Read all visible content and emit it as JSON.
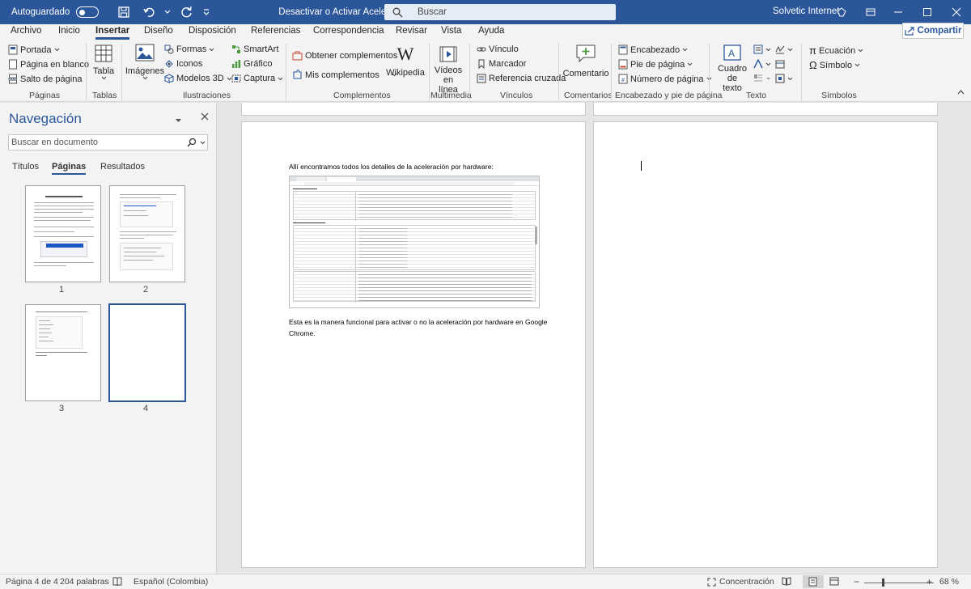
{
  "titlebar": {
    "autosave_label": "Autoguardado",
    "doc_title": "Desactivar o Activar Aceler...",
    "search_placeholder": "Buscar",
    "user_name": "Solvetic Internet"
  },
  "tabs": [
    "Archivo",
    "Inicio",
    "Insertar",
    "Diseño",
    "Disposición",
    "Referencias",
    "Correspondencia",
    "Revisar",
    "Vista",
    "Ayuda"
  ],
  "active_tab": "Insertar",
  "share_label": "Compartir",
  "ribbon": {
    "paginas": {
      "portada": "Portada",
      "pagina_blanco": "Página en blanco",
      "salto": "Salto de página",
      "label": "Páginas"
    },
    "tablas": {
      "tabla": "Tabla",
      "label": "Tablas"
    },
    "ilustraciones": {
      "imagenes": "Imágenes",
      "formas": "Formas",
      "iconos": "Iconos",
      "modelos": "Modelos 3D",
      "smartart": "SmartArt",
      "grafico": "Gráfico",
      "captura": "Captura",
      "label": "Ilustraciones"
    },
    "complementos": {
      "obtener": "Obtener complementos",
      "mis": "Mis complementos",
      "wikipedia": "Wikipedia",
      "label": "Complementos"
    },
    "multimedia": {
      "videos_1": "Vídeos",
      "videos_2": "en línea",
      "label": "Multimedia"
    },
    "vinculos": {
      "vinculo": "Vínculo",
      "marcador": "Marcador",
      "referencia": "Referencia cruzada",
      "label": "Vínculos"
    },
    "comentarios": {
      "comentario": "Comentario",
      "label": "Comentarios"
    },
    "encabezado": {
      "encabezado": "Encabezado",
      "pie": "Pie de página",
      "numero": "Número de página",
      "label": "Encabezado y pie de página"
    },
    "texto": {
      "cuadro_1": "Cuadro de",
      "cuadro_2": "texto",
      "label": "Texto"
    },
    "simbolos": {
      "ecuacion": "Ecuación",
      "simbolo": "Símbolo",
      "label": "Símbolos"
    }
  },
  "nav": {
    "title": "Navegación",
    "search_placeholder": "Buscar en documento",
    "tabs": [
      "Títulos",
      "Páginas",
      "Resultados"
    ],
    "active_tab": "Páginas",
    "pages": [
      "1",
      "2",
      "3",
      "4"
    ],
    "selected_page": "4"
  },
  "document": {
    "para1": "Allí encontramos todos los detalles de la aceleración por hardware:",
    "para2_line1": "Esta es la manera funcional para activar o no la aceleración por hardware en Google",
    "para2_line2": "Chrome."
  },
  "status": {
    "page": "Página 4 de 4",
    "words": "204 palabras",
    "language": "Español (Colombia)",
    "focus": "Concentración",
    "zoom": "68 %"
  },
  "colors": {
    "accent": "#2b579a",
    "ribbon_bg": "#f3f3f3",
    "canvas_bg": "#e6e6e6"
  }
}
